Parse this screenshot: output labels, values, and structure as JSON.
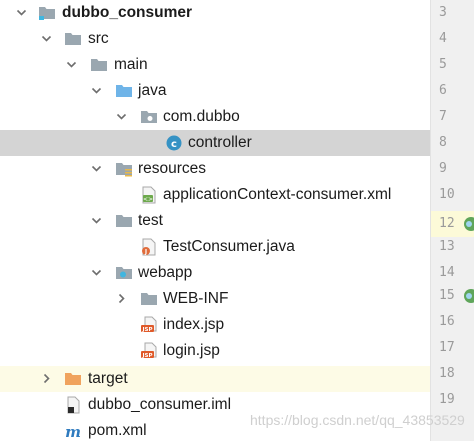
{
  "tree": {
    "items": [
      {
        "label": "dubbo_consumer",
        "icon": "module-folder-icon",
        "arrow": "down"
      },
      {
        "label": "src",
        "icon": "folder-icon",
        "arrow": "down"
      },
      {
        "label": "main",
        "icon": "folder-icon",
        "arrow": "down"
      },
      {
        "label": "java",
        "icon": "source-root-folder-icon",
        "arrow": "down"
      },
      {
        "label": "com.dubbo",
        "icon": "package-icon",
        "arrow": "down"
      },
      {
        "label": "controller",
        "icon": "class-icon",
        "arrow": "none"
      },
      {
        "label": "resources",
        "icon": "resources-folder-icon",
        "arrow": "down"
      },
      {
        "label": "applicationContext-consumer.xml",
        "icon": "spring-xml-icon",
        "arrow": "none"
      },
      {
        "label": "test",
        "icon": "folder-icon",
        "arrow": "down"
      },
      {
        "label": "TestConsumer.java",
        "icon": "java-file-icon",
        "arrow": "none"
      },
      {
        "label": "webapp",
        "icon": "web-folder-icon",
        "arrow": "down"
      },
      {
        "label": "WEB-INF",
        "icon": "folder-icon",
        "arrow": "right"
      },
      {
        "label": "index.jsp",
        "icon": "jsp-file-icon",
        "arrow": "none"
      },
      {
        "label": "login.jsp",
        "icon": "jsp-file-icon",
        "arrow": "none"
      },
      {
        "label": "target",
        "icon": "excluded-folder-icon",
        "arrow": "right"
      },
      {
        "label": "dubbo_consumer.iml",
        "icon": "iml-file-icon",
        "arrow": "none"
      },
      {
        "label": "pom.xml",
        "icon": "maven-icon",
        "arrow": "none"
      }
    ],
    "selected": "controller"
  },
  "gutter": {
    "lines": [
      "3",
      "4",
      "5",
      "6",
      "7",
      "8",
      "9",
      "10",
      "11",
      "12",
      "13",
      "14",
      "15",
      "16",
      "17",
      "18",
      "19"
    ]
  },
  "watermark": "https://blog.csdn.net/qq_43853529",
  "colors": {
    "selection": "#d4d4d4",
    "folder": "#9aa7b0",
    "source_root": "#6fb4e8",
    "class": "#3592c4",
    "excluded": "#f0a35e"
  }
}
